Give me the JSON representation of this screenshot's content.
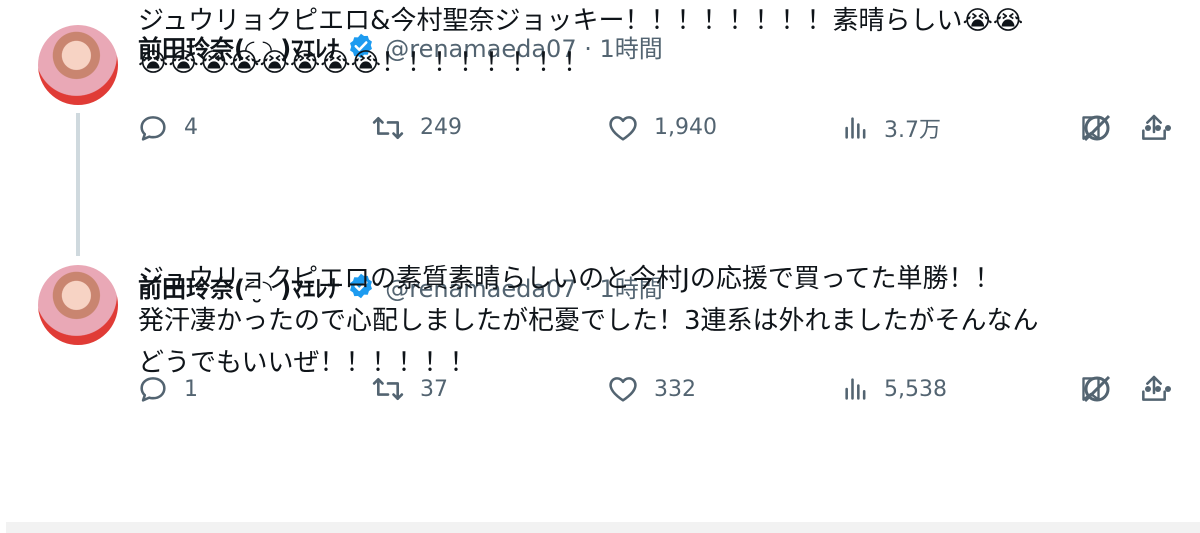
{
  "tweets": [
    {
      "name": "前田玲奈(◜ ̮◝ )ﾏｴﾚﾅ",
      "handle": "@renamaeda07 · 1時間",
      "text_line1": "ジュウリョクピエロ&今村聖奈ジョッキー！！！！！！！！素晴らしい😭😭",
      "text_line2": "😭😭😭😭😭😭😭😭！！！！！！！！",
      "replies": "4",
      "retweets": "249",
      "likes": "1,940",
      "views": "3.7万"
    },
    {
      "name": "前田玲奈(◜ ̮◝ )ﾏｴﾚﾅ",
      "handle": "@renamaeda07 · 1時間",
      "text_line1": "ジュウリョクピエロの素質素晴らしいのと今村Jの応援で買ってた単勝！！",
      "text_line2": "発汗凄かったので心配しましたが杞憂でした！3連系は外れましたがそんなん",
      "text_line3": "どうでもいいぜ！！！！！！",
      "replies": "1",
      "retweets": "37",
      "likes": "332",
      "views": "5,538"
    }
  ],
  "icons": {
    "verified": "verified-badge-icon",
    "grok": "grok-icon",
    "more": "more-icon",
    "reply": "reply-icon",
    "retweet": "retweet-icon",
    "like": "heart-icon",
    "views": "views-icon",
    "bookmark": "bookmark-icon",
    "share": "share-icon"
  },
  "colors": {
    "verified": "#1d9bf0",
    "muted": "#536471",
    "text": "#0f1419"
  }
}
